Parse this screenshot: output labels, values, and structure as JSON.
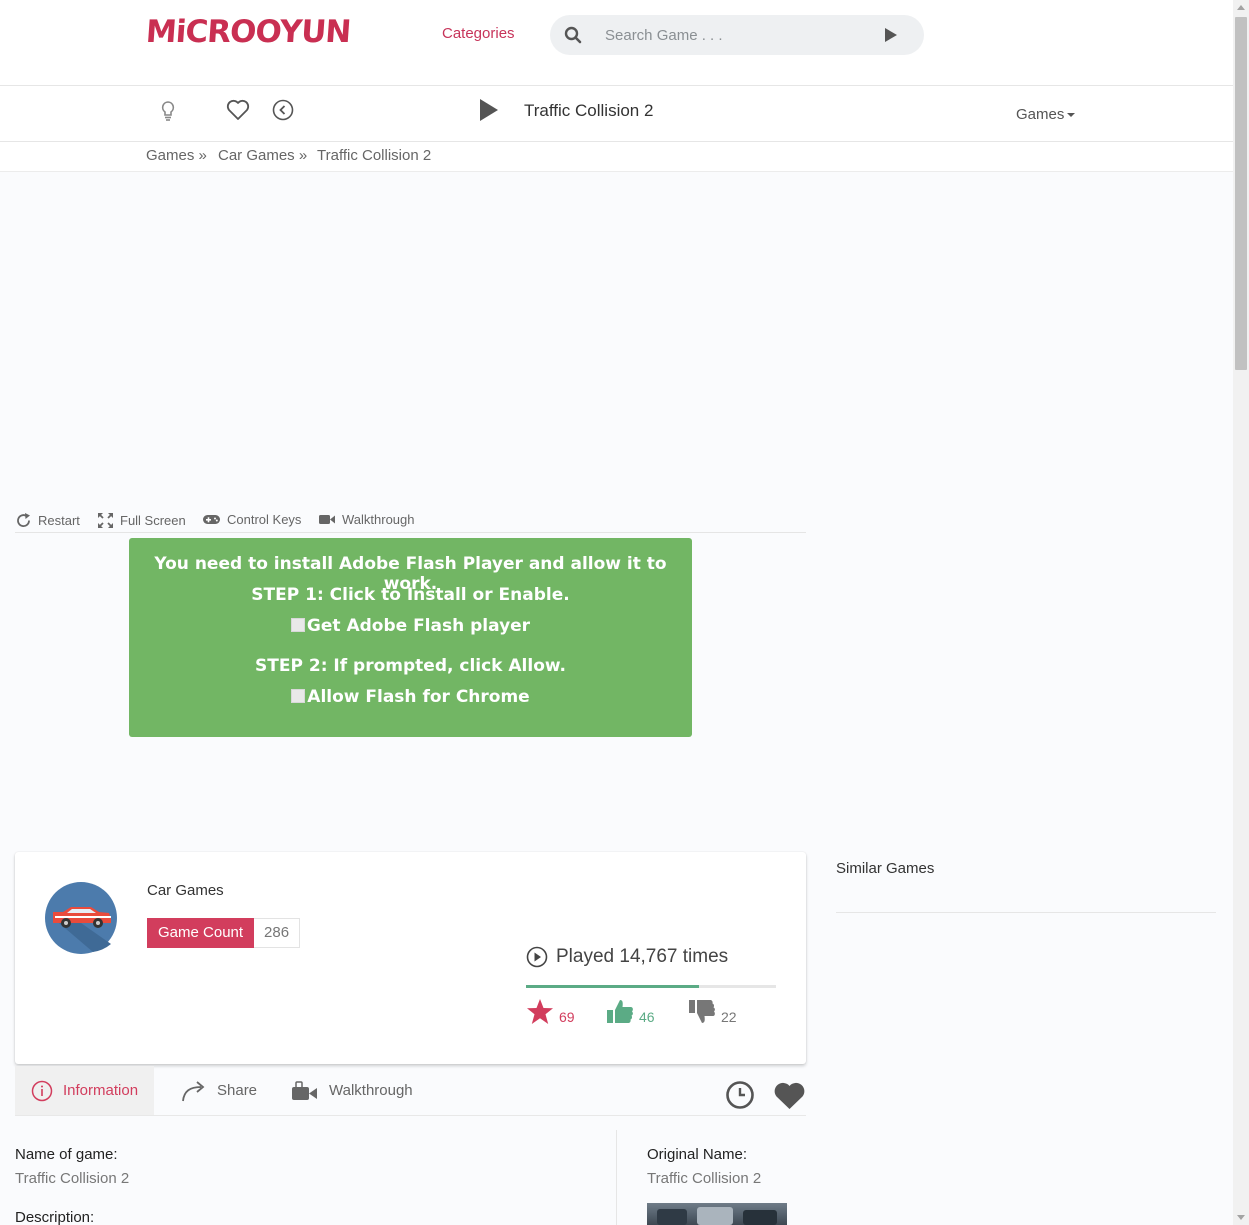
{
  "header": {
    "logo_text": "MiCROOYUN",
    "categories_label": "Categories",
    "search_placeholder": "Search Game . . ."
  },
  "toolbar": {
    "game_title": "Traffic Collision 2",
    "games_menu_label": "Games"
  },
  "breadcrumb": {
    "items": [
      "Games »",
      "Car Games »",
      "Traffic Collision 2"
    ]
  },
  "player_controls": {
    "restart": "Restart",
    "full_screen": "Full Screen",
    "control_keys": "Control Keys",
    "walkthrough": "Walkthrough"
  },
  "flash_notice": {
    "line1": "You need to install Adobe Flash Player and allow it to work.",
    "step1": "STEP 1: Click to Install or Enable.",
    "get_flash": "Get Adobe Flash player",
    "step2": "STEP 2: If prompted, click Allow.",
    "allow_flash": "Allow Flash for Chrome"
  },
  "category_card": {
    "category_name": "Car Games",
    "game_count_label": "Game Count",
    "game_count": "286",
    "played_text": "Played 14,767 times",
    "rating_progress": 0.69,
    "favorites": "69",
    "likes": "46",
    "dislikes": "22"
  },
  "tabs": {
    "information": "Information",
    "share": "Share",
    "walkthrough": "Walkthrough"
  },
  "sidebar": {
    "similar_games_title": "Similar Games"
  },
  "game_info": {
    "name_label": "Name of game:",
    "name_value": "Traffic Collision 2",
    "description_label": "Description:",
    "original_name_label": "Original Name:",
    "original_name_value": "Traffic Collision 2"
  },
  "colors": {
    "brand": "#c92f52",
    "accent_badge": "#d23d5d",
    "flash_green": "#72b664",
    "like_green": "#5bab85",
    "avatar_blue": "#4c7bac"
  }
}
